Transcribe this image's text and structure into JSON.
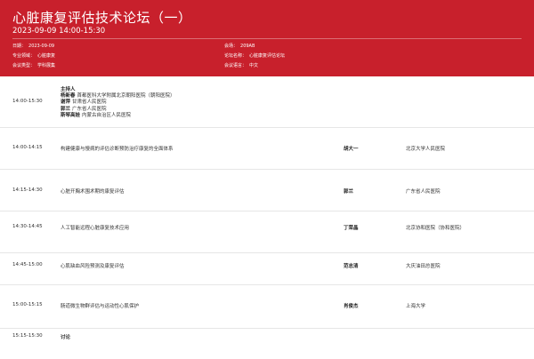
{
  "header": {
    "title": "心脏康复评估技术论坛（一）",
    "datetime": "2023-09-09   14:00-15:30",
    "meta": {
      "date_label": "日期：",
      "date_value": "2023-09-09",
      "venue_label": "会场：",
      "venue_value": "209AB",
      "field_label": "专业领域：",
      "field_value": "心脏康复",
      "forum_label": "论坛名称：",
      "forum_value": "心脏康复评估论坛",
      "type_label": "会议类型：",
      "type_value": "学科展集",
      "lang_label": "会议语言：",
      "lang_value": "中文"
    }
  },
  "hosts_block": {
    "time": "14:00-15:30",
    "label": "主持人",
    "hosts": [
      {
        "name": "杨新春",
        "org": "首都医科大学附属北京朝阳医院（朝阳医院）"
      },
      {
        "name": "谢萍",
        "org": "甘肃省人民医院"
      },
      {
        "name": "郭兰",
        "org": "广东省人民医院"
      },
      {
        "name": "斯琴高娃",
        "org": "内蒙古自治区人民医院"
      }
    ]
  },
  "sessions": [
    {
      "time": "14:00-14:15",
      "topic": "构建健康与慢病的评估诊断预防治疗康复的全面体系",
      "speaker": "胡大一",
      "institution": "北京大学人民医院"
    },
    {
      "time": "14:15-14:30",
      "topic": "心脏开胸术围术期的康复评估",
      "speaker": "郭兰",
      "institution": "广东省人民医院"
    },
    {
      "time": "14:30-14:45",
      "topic": "人工智能远程心脏康复技术应用",
      "speaker": "丁荣晶",
      "institution": "北京协和医院（协和医院）"
    },
    {
      "time": "14:45-15:00",
      "topic": "心肌缺血风险预测及康复评估",
      "speaker": "范志清",
      "institution": "大庆油田总医院"
    },
    {
      "time": "15:00-15:15",
      "topic": "肠道微生物群评估与运动性心肌保护",
      "speaker": "肖俊杰",
      "institution": "上海大学"
    }
  ],
  "discussion": {
    "time": "15:15-15:30",
    "label": "讨论"
  }
}
